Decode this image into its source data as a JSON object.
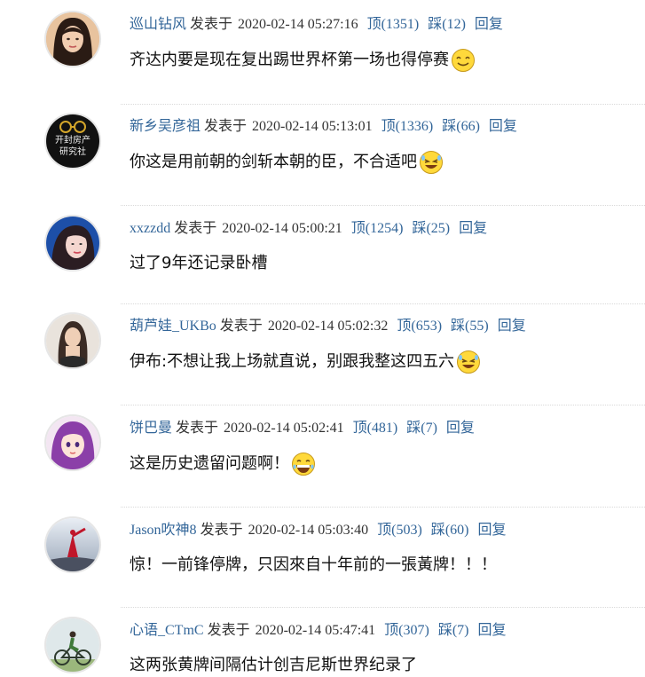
{
  "labels": {
    "posted_at": "发表于",
    "up": "顶",
    "down": "踩",
    "reply": "回复"
  },
  "comments": [
    {
      "user": "巡山钻风",
      "time": "2020-02-14 05:27:16",
      "up": "(1351)",
      "down": "(12)",
      "text": "齐达内要是现在复出踢世界杯第一场也得停赛",
      "emoji": "smile-emoji-icon",
      "avatar": "avatar-woman-dark-hair"
    },
    {
      "user": "新乡吴彦祖",
      "time": "2020-02-14 05:13:01",
      "up": "(1336)",
      "down": "(66)",
      "text": "你这是用前朝的剑斩本朝的臣，不合适吧",
      "emoji": "laugh-emoji-icon",
      "avatar": "avatar-glasses-logo",
      "avatar_text_1": "开封房产",
      "avatar_text_2": "研究社"
    },
    {
      "user": "xxzzdd",
      "time": "2020-02-14 05:00:21",
      "up": "(1254)",
      "down": "(25)",
      "text": "过了9年还记录卧槽",
      "emoji": "",
      "avatar": "avatar-woman-blue"
    },
    {
      "user": "葫芦娃_UKBo",
      "time": "2020-02-14 05:02:32",
      "up": "(653)",
      "down": "(55)",
      "text": "伊布:不想让我上场就直说，别跟我整这四五六",
      "emoji": "laugh-emoji-icon",
      "avatar": "avatar-woman-portrait"
    },
    {
      "user": "饼巴曼",
      "time": "2020-02-14 05:02:41",
      "up": "(481)",
      "down": "(7)",
      "text": "这是历史遗留问题啊！",
      "emoji": "grin-emoji-icon",
      "avatar": "avatar-anime-purple"
    },
    {
      "user": "Jason吹神8",
      "time": "2020-02-14 05:03:40",
      "up": "(503)",
      "down": "(60)",
      "text": "惊！一前锋停牌，只因來自十年前的一張黃牌！！！",
      "emoji": "",
      "avatar": "avatar-red-figure"
    },
    {
      "user": "心语_CTmC",
      "time": "2020-02-14 05:47:41",
      "up": "(307)",
      "down": "(7)",
      "text": "这两张黄牌间隔估计创吉尼斯世界纪录了",
      "emoji": "",
      "avatar": "avatar-cyclist"
    }
  ],
  "colors": {
    "link": "#336699",
    "text": "#111111",
    "divider": "#d9d9d9"
  }
}
